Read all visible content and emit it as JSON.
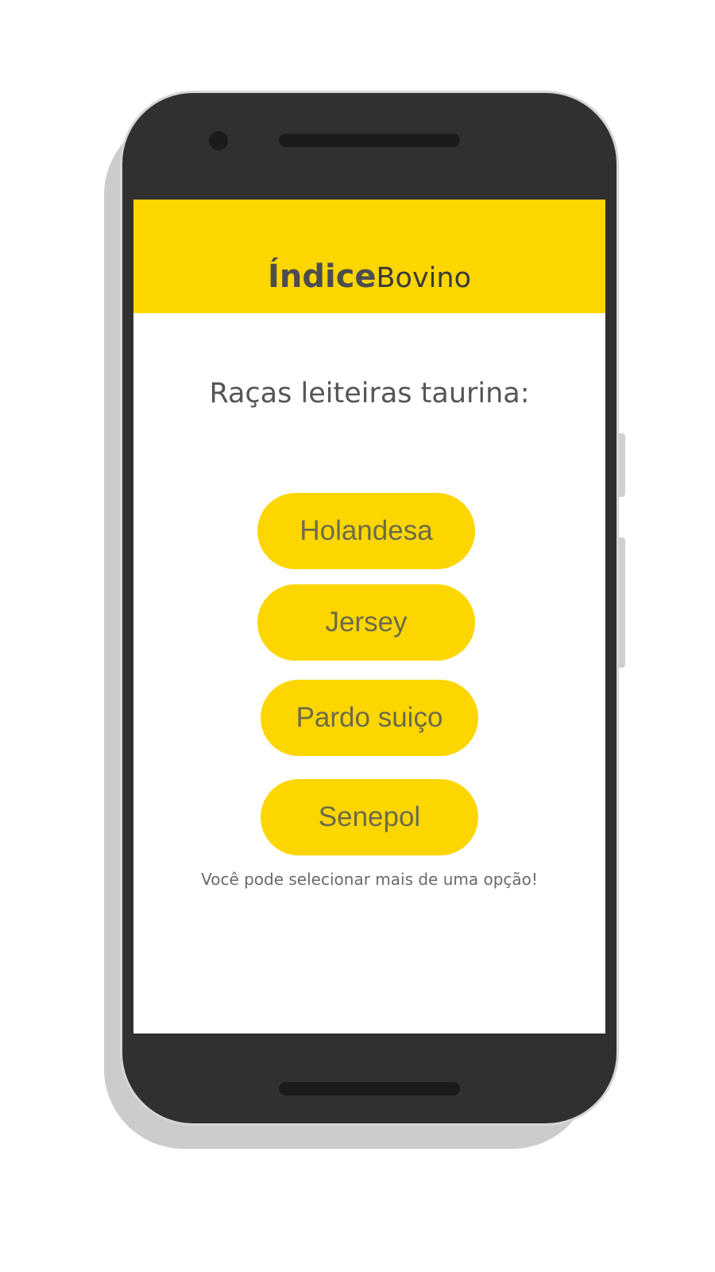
{
  "app": {
    "logo_bold": "Índice",
    "logo_light": "Bovino"
  },
  "screen": {
    "heading": "Raças leiteiras taurina:",
    "breeds": [
      {
        "label": "Holandesa"
      },
      {
        "label": "Jersey"
      },
      {
        "label": "Pardo suiço"
      },
      {
        "label": "Senepol"
      }
    ],
    "hint": "Você pode selecionar mais de uma opção!"
  },
  "colors": {
    "accent": "#fdd600",
    "device_body": "#303030",
    "text": "#555555"
  }
}
